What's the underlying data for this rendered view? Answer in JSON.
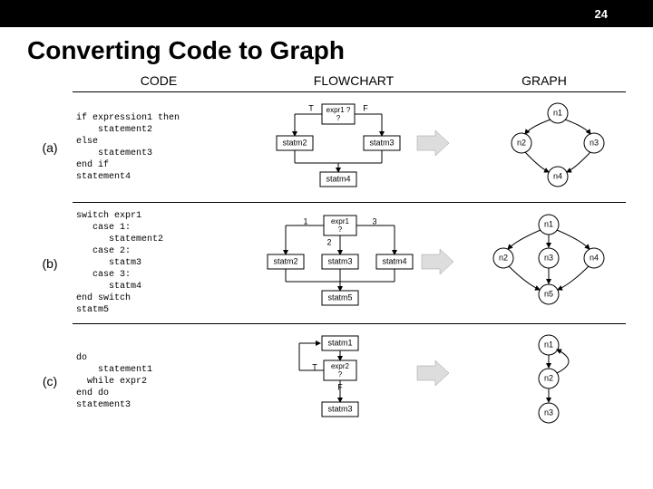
{
  "page_number": "24",
  "title": "Converting Code to Graph",
  "headers": {
    "code": "CODE",
    "flowchart": "FLOWCHART",
    "graph": "GRAPH"
  },
  "rows": [
    {
      "label": "(a)",
      "code": "if expression1 then\n    statement2\nelse\n    statement3\nend if\nstatement4",
      "flow_labels": {
        "cond": "expr1\n?",
        "t": "T",
        "f": "F",
        "s2": "statm2",
        "s3": "statm3",
        "s4": "statm4"
      },
      "graph_nodes": [
        "n1",
        "n2",
        "n3",
        "n4"
      ]
    },
    {
      "label": "(b)",
      "code": "switch expr1\n   case 1:\n      statement2\n   case 2:\n      statm3\n   case 3:\n      statm4\nend switch\nstatm5",
      "flow_labels": {
        "cond": "expr1\n?",
        "c1": "1",
        "c2": "2",
        "c3": "3",
        "s2": "statm2",
        "s3": "statm3",
        "s4": "statm4",
        "s5": "statm5"
      },
      "graph_nodes": [
        "n1",
        "n2",
        "n3",
        "n4",
        "n5"
      ]
    },
    {
      "label": "(c)",
      "code": "do\n    statement1\n  while expr2\nend do\nstatement3",
      "flow_labels": {
        "s1": "statm1",
        "cond": "expr2\n?",
        "t": "T",
        "f": "F",
        "s3": "statm3"
      },
      "graph_nodes": [
        "n1",
        "n2",
        "n3"
      ]
    }
  ]
}
